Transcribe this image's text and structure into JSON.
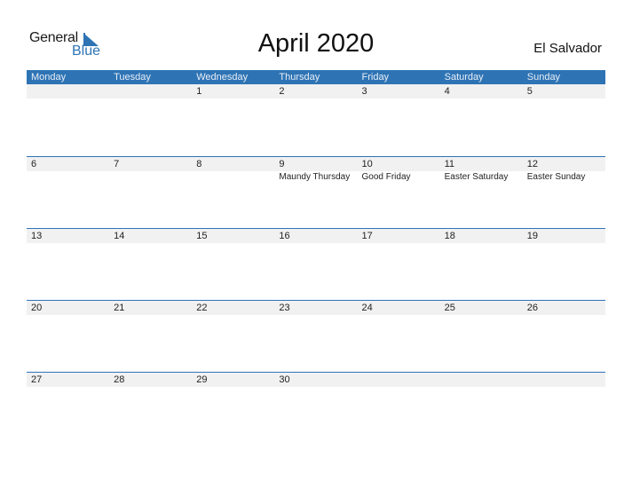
{
  "logo": {
    "line1": "General",
    "line2": "Blue"
  },
  "title": "April 2020",
  "country": "El Salvador",
  "colors": {
    "accent": "#2e74b5",
    "day_row_bg": "#f1f1f1"
  },
  "weekdays": [
    "Monday",
    "Tuesday",
    "Wednesday",
    "Thursday",
    "Friday",
    "Saturday",
    "Sunday"
  ],
  "weeks": [
    {
      "days": [
        "",
        "",
        "1",
        "2",
        "3",
        "4",
        "5"
      ],
      "events": [
        "",
        "",
        "",
        "",
        "",
        "",
        ""
      ]
    },
    {
      "days": [
        "6",
        "7",
        "8",
        "9",
        "10",
        "11",
        "12"
      ],
      "events": [
        "",
        "",
        "",
        "Maundy Thursday",
        "Good Friday",
        "Easter Saturday",
        "Easter Sunday"
      ]
    },
    {
      "days": [
        "13",
        "14",
        "15",
        "16",
        "17",
        "18",
        "19"
      ],
      "events": [
        "",
        "",
        "",
        "",
        "",
        "",
        ""
      ]
    },
    {
      "days": [
        "20",
        "21",
        "22",
        "23",
        "24",
        "25",
        "26"
      ],
      "events": [
        "",
        "",
        "",
        "",
        "",
        "",
        ""
      ]
    },
    {
      "days": [
        "27",
        "28",
        "29",
        "30",
        "",
        "",
        ""
      ],
      "events": [
        "",
        "",
        "",
        "",
        "",
        "",
        ""
      ]
    }
  ]
}
